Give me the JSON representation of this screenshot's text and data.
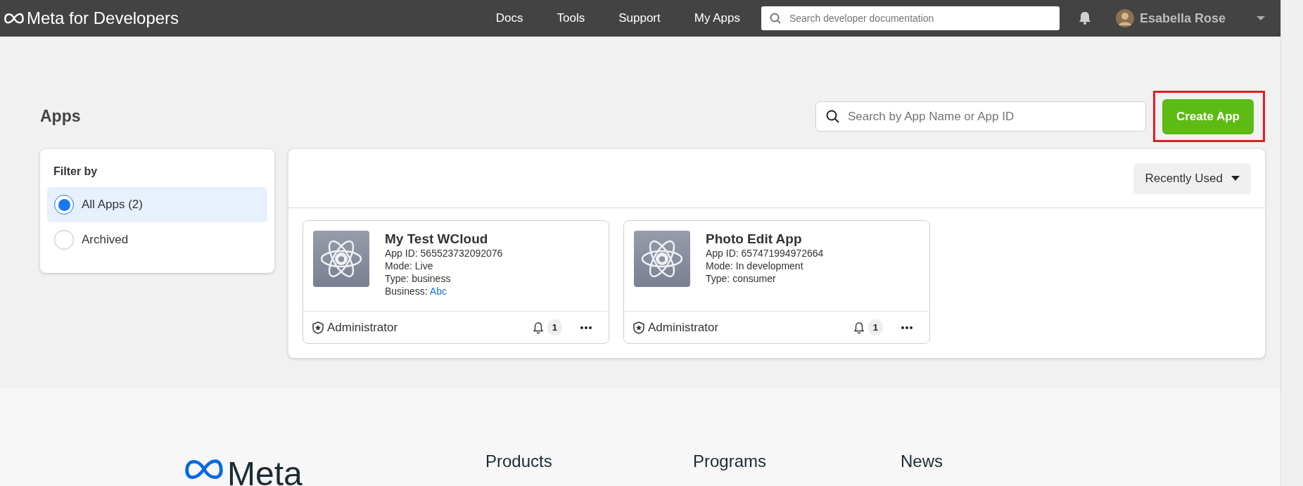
{
  "navbar": {
    "logo": "Meta for Developers",
    "links": [
      {
        "label": "Docs"
      },
      {
        "label": "Tools"
      },
      {
        "label": "Support"
      },
      {
        "label": "My Apps"
      }
    ],
    "search": {
      "placeholder": "Search developer documentation"
    },
    "user": {
      "name": "Esabella Rose"
    }
  },
  "header": {
    "title": "Apps",
    "search": {
      "placeholder": "Search by App Name or App ID"
    },
    "create_button": {
      "label": "Create App",
      "highlighted": true
    }
  },
  "filter": {
    "title": "Filter by",
    "options": [
      {
        "label": "All Apps (2)",
        "selected": true
      },
      {
        "label": "Archived",
        "selected": false
      }
    ]
  },
  "sort": {
    "label": "Recently Used"
  },
  "apps": [
    {
      "name": "My Test WCloud",
      "details": [
        "App ID: 565523732092076",
        "Mode: Live",
        "Type: business"
      ],
      "business": {
        "label": "Business:",
        "value": "Abc"
      },
      "role": "Administrator",
      "notifications": "1"
    },
    {
      "name": "Photo Edit App",
      "details": [
        "App ID: 657471994972664",
        "Mode: In development",
        "Type: consumer"
      ],
      "role": "Administrator",
      "notifications": "1"
    }
  ],
  "footer": {
    "logo": "Meta",
    "columns": [
      "Products",
      "Programs",
      "News"
    ]
  }
}
